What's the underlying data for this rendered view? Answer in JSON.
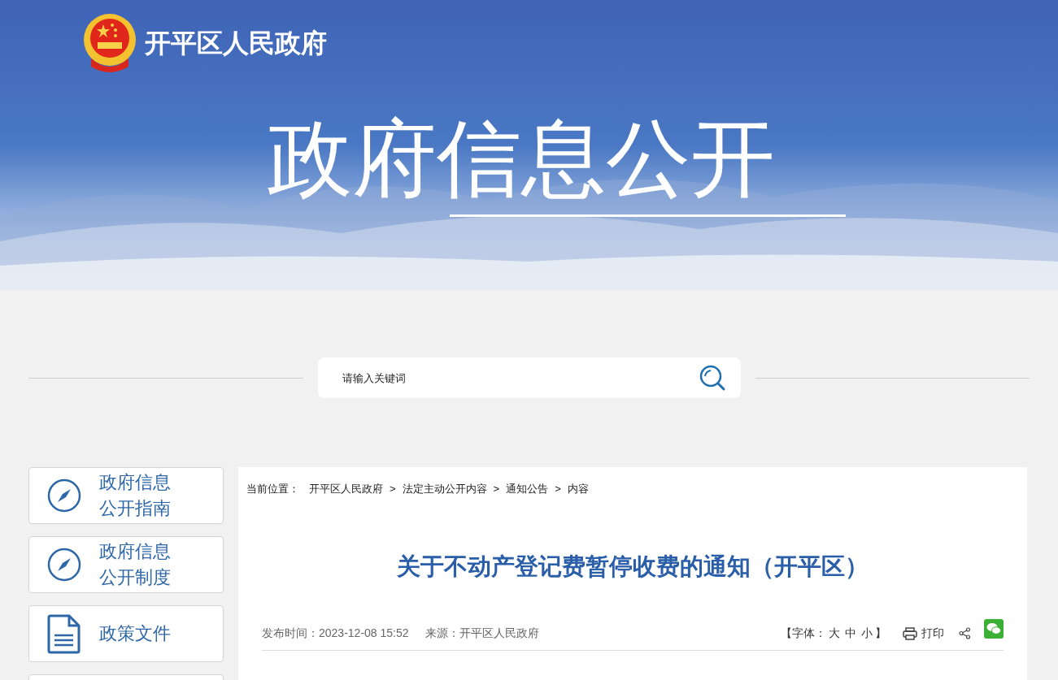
{
  "header": {
    "site_name": "开平区人民政府",
    "banner_title": "政府信息公开"
  },
  "search": {
    "placeholder": "请输入关键词"
  },
  "sidebar": {
    "items": [
      {
        "label": "政府信息公开指南",
        "kind": "compass"
      },
      {
        "label": "政府信息公开制度",
        "kind": "compass"
      },
      {
        "label": "政策文件",
        "kind": "document"
      }
    ]
  },
  "breadcrumb": {
    "label": "当前位置：",
    "items": [
      "开平区人民政府",
      "法定主动公开内容",
      "通知公告",
      "内容"
    ],
    "separator": ">"
  },
  "article": {
    "title": "关于不动产登记费暂停收费的通知（开平区）",
    "published": "发布时间：2023-12-08 15:52",
    "source": "来源：开平区人民政府",
    "font_size": {
      "open": "【字体：",
      "options": [
        "大",
        "中",
        "小"
      ],
      "close": "】"
    },
    "print": "打印"
  }
}
